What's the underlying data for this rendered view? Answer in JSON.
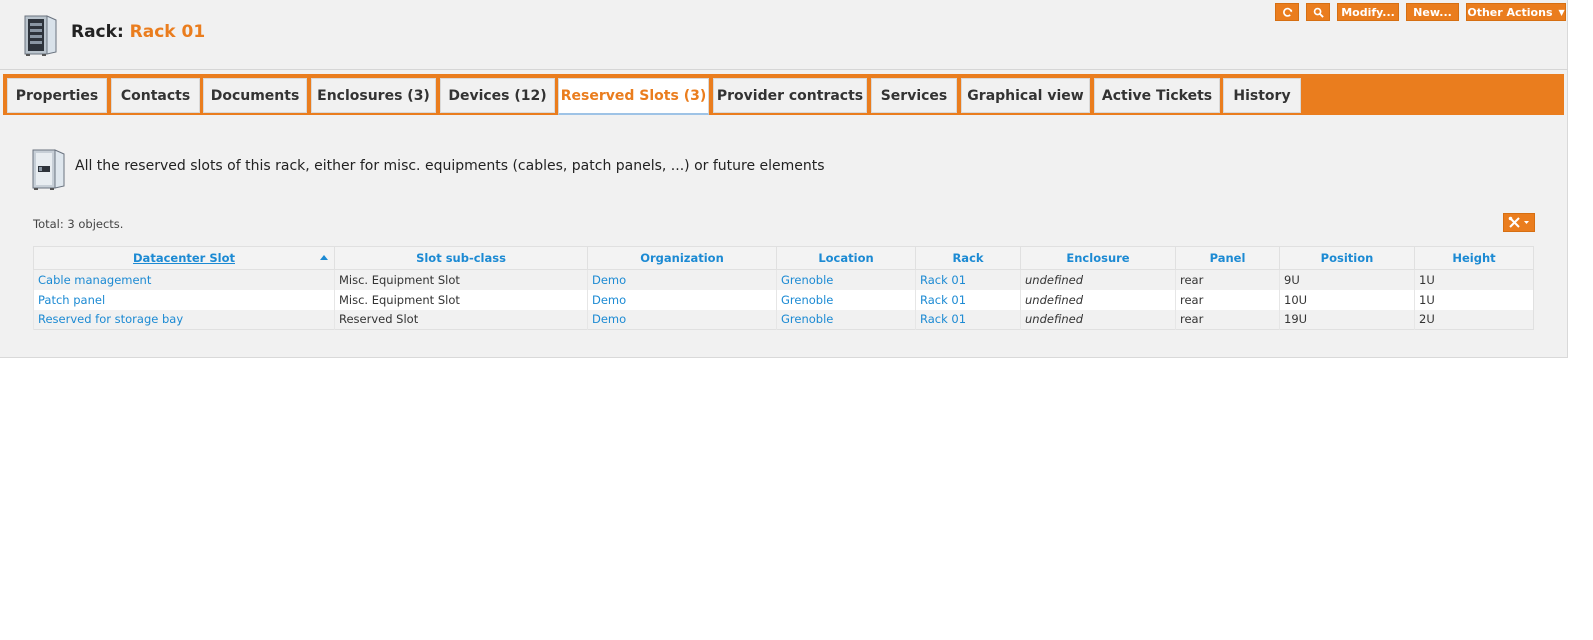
{
  "header": {
    "object_class": "Rack:",
    "object_name": "Rack 01"
  },
  "actions": {
    "refresh_icon": "refresh-icon",
    "search_icon": "search-icon",
    "modify_label": "Modify...",
    "new_label": "New...",
    "other_actions_label": "Other Actions"
  },
  "tabs": [
    {
      "label": "Properties"
    },
    {
      "label": "Contacts"
    },
    {
      "label": "Documents"
    },
    {
      "label": "Enclosures (3)"
    },
    {
      "label": "Devices (12)"
    },
    {
      "label": "Reserved Slots (3)"
    },
    {
      "label": "Provider contracts"
    },
    {
      "label": "Services"
    },
    {
      "label": "Graphical view"
    },
    {
      "label": "Active Tickets"
    },
    {
      "label": "History"
    }
  ],
  "active_tab": "Reserved Slots (3)",
  "intro": {
    "text": "All the reserved slots of this rack, either for misc. equipments (cables, patch panels, ...) or future elements"
  },
  "list": {
    "total_text": "Total: 3 objects.",
    "columns": [
      "Datacenter Slot",
      "Slot sub-class",
      "Organization",
      "Location",
      "Rack",
      "Enclosure",
      "Panel",
      "Position",
      "Height"
    ],
    "rows": [
      [
        "Cable management",
        "Misc. Equipment Slot",
        "Demo",
        "Grenoble",
        "Rack 01",
        "undefined",
        "rear",
        "9U",
        "1U"
      ],
      [
        "Patch panel",
        "Misc. Equipment Slot",
        "Demo",
        "Grenoble",
        "Rack 01",
        "undefined",
        "rear",
        "10U",
        "1U"
      ],
      [
        "Reserved for storage bay",
        "Reserved Slot",
        "Demo",
        "Grenoble",
        "Rack 01",
        "undefined",
        "rear",
        "19U",
        "2U"
      ]
    ]
  },
  "colors": {
    "accent": "#ea7d1e",
    "link": "#1c8ad3",
    "panel_bg": "#f1f1f1"
  }
}
